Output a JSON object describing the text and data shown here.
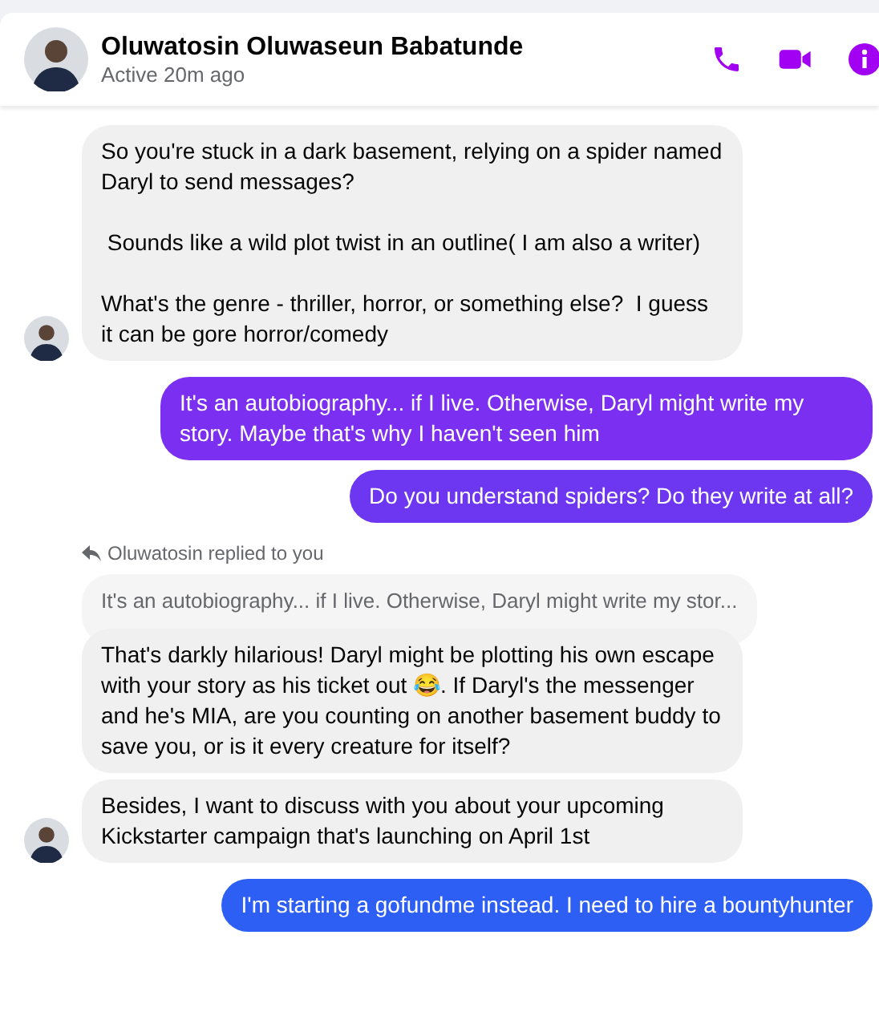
{
  "header": {
    "name": "Oluwatosin Oluwaseun Babatunde",
    "status": "Active 20m ago"
  },
  "messages": [
    {
      "kind": "incoming",
      "avatar": true,
      "text": "So you're stuck in a dark basement, relying on a spider named Daryl to send messages?\n\n Sounds like a wild plot twist in an outline( I am also a writer)\n\nWhat's the genre - thriller, horror, or something else?  I guess it can be gore horror/comedy"
    },
    {
      "kind": "outgoing",
      "color": "#7b2ff0",
      "text": "It's an autobiography... if I live. Otherwise, Daryl might write my story. Maybe that's why I haven't seen him"
    },
    {
      "kind": "outgoing",
      "color": "#6d36f0",
      "text": "Do you understand spiders? Do they write at all?"
    },
    {
      "kind": "reply",
      "label": "Oluwatosin replied to you",
      "quote": "It's an autobiography... if I live. Otherwise, Daryl might write my stor..."
    },
    {
      "kind": "incoming",
      "avatar": false,
      "text": "That's darkly hilarious! Daryl might be plotting his own escape with your story as his ticket out 😂. If Daryl's the messenger and he's MIA, are you counting on another basement buddy to save you, or is it every creature for itself?"
    },
    {
      "kind": "incoming",
      "avatar": true,
      "text": "Besides, I want to discuss with you about your upcoming Kickstarter campaign that's launching on April 1st"
    },
    {
      "kind": "outgoing",
      "color": "#2d5ff5",
      "text": "I'm starting a gofundme instead. I need to hire a bountyhunter"
    }
  ]
}
